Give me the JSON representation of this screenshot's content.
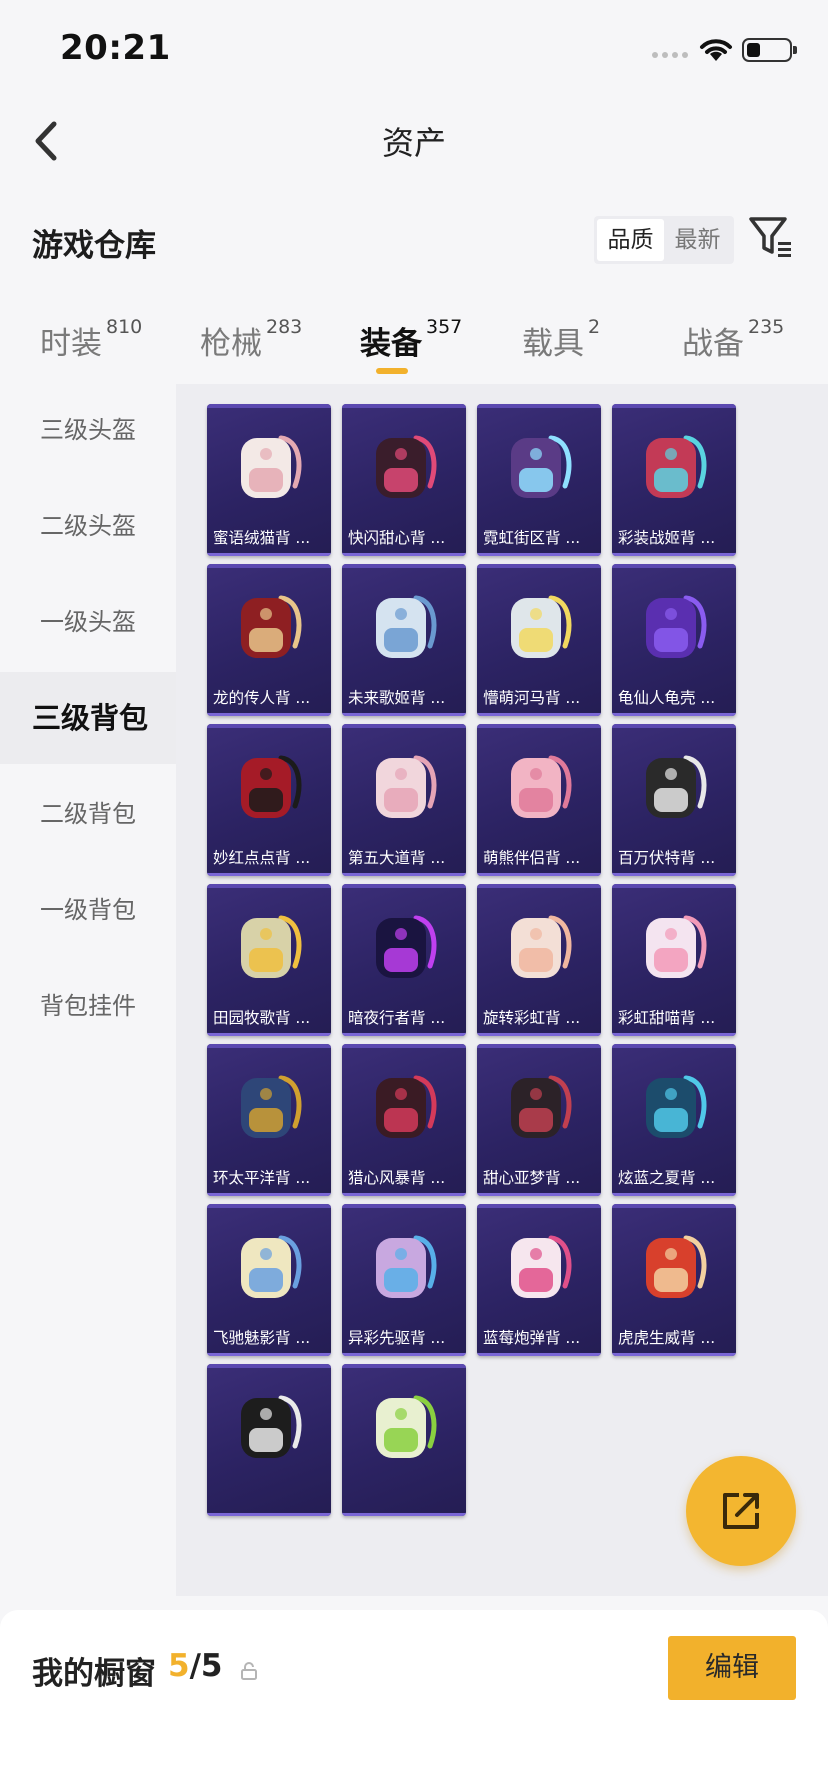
{
  "status": {
    "time": "20:21"
  },
  "nav": {
    "title": "资产"
  },
  "warehouse": {
    "title": "游戏仓库",
    "sort_options": [
      "品质",
      "最新"
    ]
  },
  "tabs": [
    {
      "label": "时装",
      "count": "810"
    },
    {
      "label": "枪械",
      "count": "283"
    },
    {
      "label": "装备",
      "count": "357"
    },
    {
      "label": "载具",
      "count": "2"
    },
    {
      "label": "战备",
      "count": "235"
    }
  ],
  "categories": [
    "三级头盔",
    "二级头盔",
    "一级头盔",
    "三级背包",
    "二级背包",
    "一级背包",
    "背包挂件"
  ],
  "items": [
    {
      "name": "蜜语绒猫背 ..."
    },
    {
      "name": "快闪甜心背 ..."
    },
    {
      "name": "霓虹街区背 ..."
    },
    {
      "name": "彩装战姬背 ..."
    },
    {
      "name": "龙的传人背 ..."
    },
    {
      "name": "未来歌姬背 ..."
    },
    {
      "name": "懵萌河马背 ..."
    },
    {
      "name": "龟仙人龟壳 ..."
    },
    {
      "name": "妙红点点背 ..."
    },
    {
      "name": "第五大道背 ..."
    },
    {
      "name": "萌熊伴侣背 ..."
    },
    {
      "name": "百万伏特背 ..."
    },
    {
      "name": "田园牧歌背 ..."
    },
    {
      "name": "暗夜行者背 ..."
    },
    {
      "name": "旋转彩虹背 ..."
    },
    {
      "name": "彩虹甜喵背 ..."
    },
    {
      "name": "环太平洋背 ..."
    },
    {
      "name": "猎心风暴背 ..."
    },
    {
      "name": "甜心亚梦背 ..."
    },
    {
      "name": "炫蓝之夏背 ..."
    },
    {
      "name": "飞驰魅影背 ..."
    },
    {
      "name": "异彩先驱背 ..."
    },
    {
      "name": "蓝莓炮弹背 ..."
    },
    {
      "name": "虎虎生威背 ..."
    },
    {
      "name": ""
    },
    {
      "name": ""
    }
  ],
  "showcase": {
    "label": "我的橱窗",
    "current": "5",
    "separator": "/",
    "max": "5",
    "edit_label": "编辑"
  },
  "colors": {
    "accent": "#f2b12c",
    "card_bg": "#2c2363"
  }
}
